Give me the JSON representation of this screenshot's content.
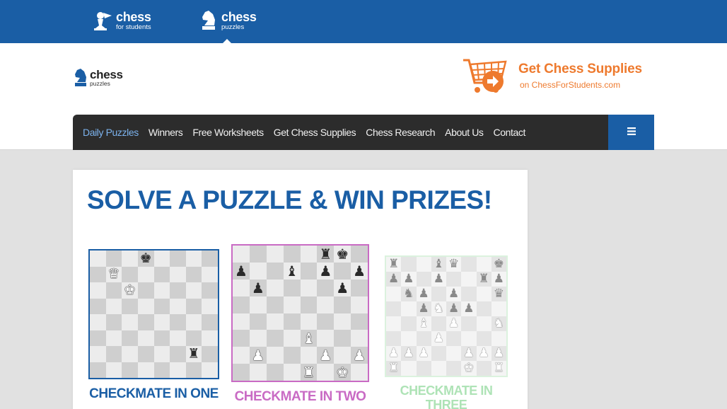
{
  "topbar": {
    "sites": [
      {
        "main": "chess",
        "sub": "for students"
      },
      {
        "main": "chess",
        "sub": "puzzles"
      }
    ]
  },
  "brand": {
    "main": "chess",
    "sub": "puzzles"
  },
  "supplies_banner": {
    "title": "Get Chess Supplies",
    "subtitle": "on ChessForStudents.com",
    "color": "#ee7a2e"
  },
  "nav": {
    "items": [
      "Daily Puzzles",
      "Winners",
      "Free Worksheets",
      "Get Chess Supplies",
      "Chess Research",
      "About Us",
      "Contact"
    ],
    "active_index": 0,
    "menu_icon": "hamburger-icon"
  },
  "main": {
    "heading": "SOLVE A PUZZLE & WIN PRIZES!",
    "puzzles": [
      {
        "label": "CHECKMATE IN ONE",
        "accent": "#1a5ea5",
        "board": [
          "...k....",
          ".Q......",
          "..K.....",
          "........",
          "........",
          "........",
          "......r.",
          "........"
        ]
      },
      {
        "label": "CHECKMATE IN TWO",
        "accent": "#c96bc4",
        "board": [
          ".....rk.",
          "p..b.p.p",
          ".p....p.",
          "........",
          "........",
          "....B...",
          ".P...P.P",
          "....R.K."
        ]
      },
      {
        "label": "CHECKMATE IN THREE",
        "accent": "#aee3b6",
        "board": [
          "r..bq..k",
          "pp.p..rp",
          ".np.p..q",
          "..pNpp..",
          "..B.P..N",
          "...P....",
          "PPP..PPP",
          "R....K.R"
        ]
      }
    ]
  }
}
